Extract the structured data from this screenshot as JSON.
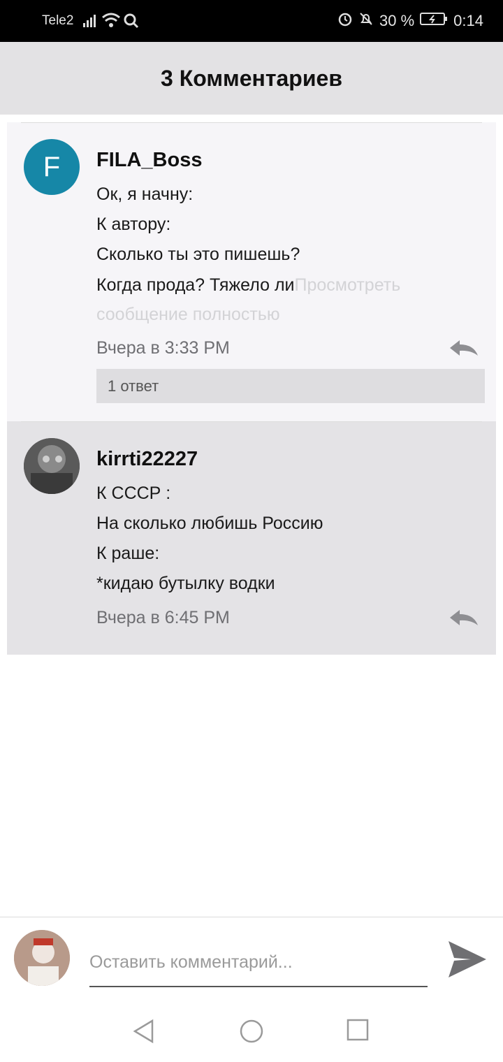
{
  "status_bar": {
    "carrier": "Tele2",
    "battery": "30 %",
    "time": "0:14",
    "icons": [
      "signal-icon",
      "wifi-icon",
      "search-icon",
      "alarm-icon",
      "mute-icon",
      "battery-icon"
    ]
  },
  "header": {
    "title": "3 Комментариев"
  },
  "comments": [
    {
      "avatar_letter": "F",
      "avatar_color": "#1687a7",
      "username": "FILA_Boss",
      "lines": [
        "Ок, я начну:",
        "К автору:",
        "Сколько ты это пишешь?",
        "Когда прода? Тяжело ли"
      ],
      "more_inline": "Просмотреть",
      "more_line2": "сообщение полностью",
      "time": "Вчера в 3:33 PM",
      "replies": "1 ответ"
    },
    {
      "username": "kirrti22227",
      "lines": [
        "К СССР :",
        "На сколько любишь Россию",
        "К раше:",
        "*кидаю бутылку водки"
      ],
      "time": "Вчера в 6:45 PM"
    }
  ],
  "input": {
    "placeholder": "Оставить комментарий..."
  },
  "colors": {
    "header_bg": "#e3e2e4",
    "comment1_bg": "#f6f5f8",
    "comment2_bg": "#e4e3e6",
    "accent": "#1687a7"
  }
}
